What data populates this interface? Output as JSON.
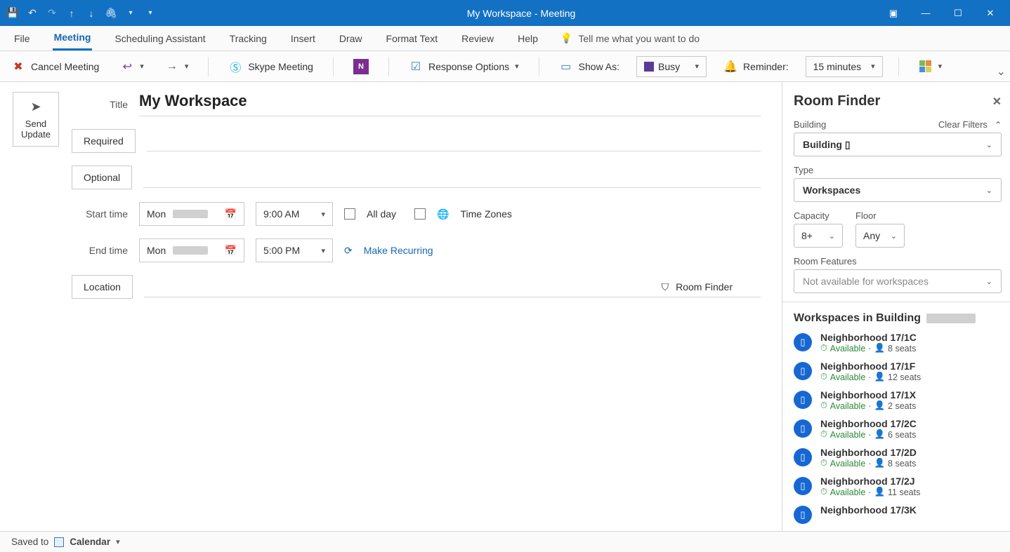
{
  "window": {
    "title": "My Workspace - Meeting"
  },
  "tabs": {
    "file": "File",
    "meeting": "Meeting",
    "scheduling": "Scheduling Assistant",
    "tracking": "Tracking",
    "insert": "Insert",
    "draw": "Draw",
    "format": "Format Text",
    "review": "Review",
    "help": "Help",
    "tellme": "Tell me what you want to do"
  },
  "ribbon": {
    "cancel": "Cancel Meeting",
    "skype": "Skype Meeting",
    "response": "Response Options",
    "showas_label": "Show As:",
    "showas_value": "Busy",
    "reminder_label": "Reminder:",
    "reminder_value": "15 minutes"
  },
  "compose": {
    "send1": "Send",
    "send2": "Update",
    "title_label": "Title",
    "title_value": "My Workspace",
    "required": "Required",
    "optional": "Optional",
    "start_label": "Start time",
    "end_label": "End time",
    "start_day": "Mon",
    "end_day": "Mon",
    "start_time": "9:00 AM",
    "end_time": "5:00 PM",
    "allday": "All day",
    "timezones": "Time Zones",
    "recurring": "Make Recurring",
    "location": "Location",
    "roomfinder": "Room Finder"
  },
  "rf": {
    "title": "Room Finder",
    "building_label": "Building",
    "clear": "Clear Filters",
    "building_value": "Building ▯",
    "type_label": "Type",
    "type_value": "Workspaces",
    "capacity_label": "Capacity",
    "capacity_value": "8+",
    "floor_label": "Floor",
    "floor_value": "Any",
    "features_label": "Room Features",
    "features_value": "Not available for workspaces",
    "list_title": "Workspaces in Building",
    "available": "Available",
    "items": [
      {
        "name": "Neighborhood 17/1C",
        "seats": "8 seats"
      },
      {
        "name": "Neighborhood 17/1F",
        "seats": "12 seats"
      },
      {
        "name": "Neighborhood 17/1X",
        "seats": "2 seats"
      },
      {
        "name": "Neighborhood 17/2C",
        "seats": "6 seats"
      },
      {
        "name": "Neighborhood 17/2D",
        "seats": "8 seats"
      },
      {
        "name": "Neighborhood 17/2J",
        "seats": "11 seats"
      },
      {
        "name": "Neighborhood 17/3K",
        "seats": ""
      }
    ]
  },
  "status": {
    "saved": "Saved to",
    "calendar": "Calendar"
  }
}
